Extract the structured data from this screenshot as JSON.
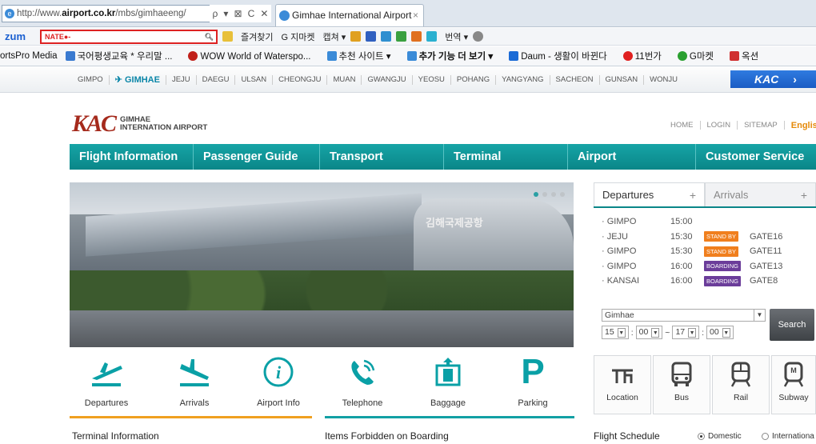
{
  "browser": {
    "url_prefix": "http://www.",
    "url_domain": "airport.co.kr",
    "url_path": "/mbs/gimhaeeng/",
    "url_controls": [
      "ρ",
      "▾",
      "⊠",
      "C",
      "✕"
    ],
    "tab_title": "Gimhae International Airport",
    "tab_close": "×"
  },
  "toolbar": {
    "logo": "zum",
    "search_value": "NATE●-",
    "items": [
      "즐겨찾기",
      "G 지마켓",
      "캡쳐 ▾",
      "번역 ▾"
    ]
  },
  "favorites": [
    "ortsPro Media",
    "국어평생교육 * 우리말 ...",
    "WOW World of Waterspo...",
    "추천 사이트 ▾",
    "추가 기능 더 보기 ▾",
    "Daum - 생활이 바뀐다",
    "11번가",
    "G마켓",
    "옥션"
  ],
  "airport_nav": [
    "GIMPO",
    "GIMHAE",
    "JEJU",
    "DAEGU",
    "ULSAN",
    "CHEONGJU",
    "MUAN",
    "GWANGJU",
    "YEOSU",
    "POHANG",
    "YANGYANG",
    "SACHEON",
    "GUNSAN",
    "WONJU"
  ],
  "kac_button": "KAC",
  "logo": {
    "mark": "KAC",
    "line1": "GIMHAE",
    "line2": "INTERNATION AIRPORT"
  },
  "utility": [
    "HOME",
    "LOGIN",
    "SITEMAP",
    "English ▾"
  ],
  "main_nav": [
    "Flight Information",
    "Passenger Guide",
    "Transport",
    "Terminal Information",
    "Airport Introduction",
    "Customer Service"
  ],
  "hero": {
    "sign_text": "김해국제공항"
  },
  "board": {
    "tab_departures": "Departures",
    "tab_arrivals": "Arrivals",
    "plus": "+",
    "flights": [
      {
        "city": "· GIMPO",
        "time": "15:00",
        "status": "",
        "gate": ""
      },
      {
        "city": "· JEJU",
        "time": "15:30",
        "status": "STAND BY",
        "gate": "GATE16"
      },
      {
        "city": "· GIMPO",
        "time": "15:30",
        "status": "STAND BY",
        "gate": "GATE11"
      },
      {
        "city": "· GIMPO",
        "time": "16:00",
        "status": "BOARDING",
        "gate": "GATE13"
      },
      {
        "city": "· KANSAI",
        "time": "16:00",
        "status": "BOARDING",
        "gate": "GATE8"
      }
    ],
    "airport_select": "Gimhae",
    "from_hour": "15",
    "from_min": "00",
    "to_hour": "17",
    "to_min": "00",
    "range_sep": "~",
    "colon": ":",
    "search": "Search",
    "colors": {
      "standby": "#f07f1e",
      "boarding": "#6b3d9a"
    }
  },
  "services": [
    "Departures",
    "Arrivals",
    "Airport Info",
    "Telephone",
    "Baggage",
    "Parking"
  ],
  "transport": [
    "Location",
    "Bus",
    "Rail",
    "Subway"
  ],
  "bottom": {
    "terminal": "Terminal Information",
    "forbidden": "Items Forbidden on Boarding",
    "schedule": "Flight Schedule",
    "domestic": "Domestic",
    "international": "Internationa"
  }
}
